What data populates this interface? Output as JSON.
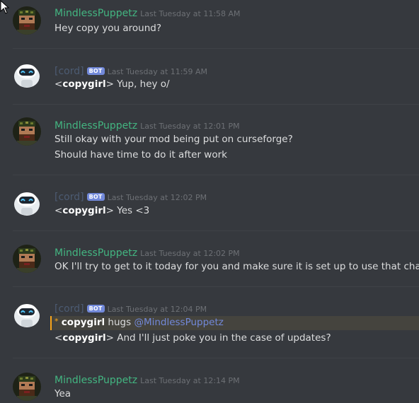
{
  "messages": [
    {
      "author": "MindlessPuppetz",
      "timestamp": "Last Tuesday at 11:58 AM",
      "lines": [
        "Hey copy you around?"
      ]
    },
    {
      "author": "[cord]",
      "bot_tag": "BOT",
      "timestamp": "Last Tuesday at 11:59 AM",
      "relay_user": "copygirl",
      "relay_text": "Yup, hey o/"
    },
    {
      "author": "MindlessPuppetz",
      "timestamp": "Last Tuesday at 12:01 PM",
      "lines": [
        "Still okay with your mod being put on curseforge?",
        "Should have time to do it after work"
      ]
    },
    {
      "author": "[cord]",
      "bot_tag": "BOT",
      "timestamp": "Last Tuesday at 12:02 PM",
      "relay_user": "copygirl",
      "relay_text": "Yes <3"
    },
    {
      "author": "MindlessPuppetz",
      "timestamp": "Last Tuesday at 12:02 PM",
      "lines": [
        "OK I'll try to get to it today for you and make sure it is set up to use that charity"
      ]
    },
    {
      "author": "[cord]",
      "bot_tag": "BOT",
      "timestamp": "Last Tuesday at 12:04 PM",
      "action_star": "*",
      "action_user": "copygirl",
      "action_verb": "hugs",
      "action_mention": "@MindlessPuppetz",
      "relay_user": "copygirl",
      "relay_text": "And I'll just poke you in the case of updates?"
    },
    {
      "author": "MindlessPuppetz",
      "timestamp": "Last Tuesday at 12:14 PM",
      "lines": [
        "Yea"
      ]
    }
  ],
  "colors": {
    "user_name": "#43b581",
    "bot_name": "#4c5b72",
    "bot_tag_bg": "#7289da",
    "background": "#36393e",
    "action_highlight": "#faa61a"
  },
  "icons": {
    "human_avatar": "pixel-art-bearded-character-avatar",
    "bot_avatar": "white-robot-avatar",
    "cursor": "mouse-pointer-icon"
  }
}
